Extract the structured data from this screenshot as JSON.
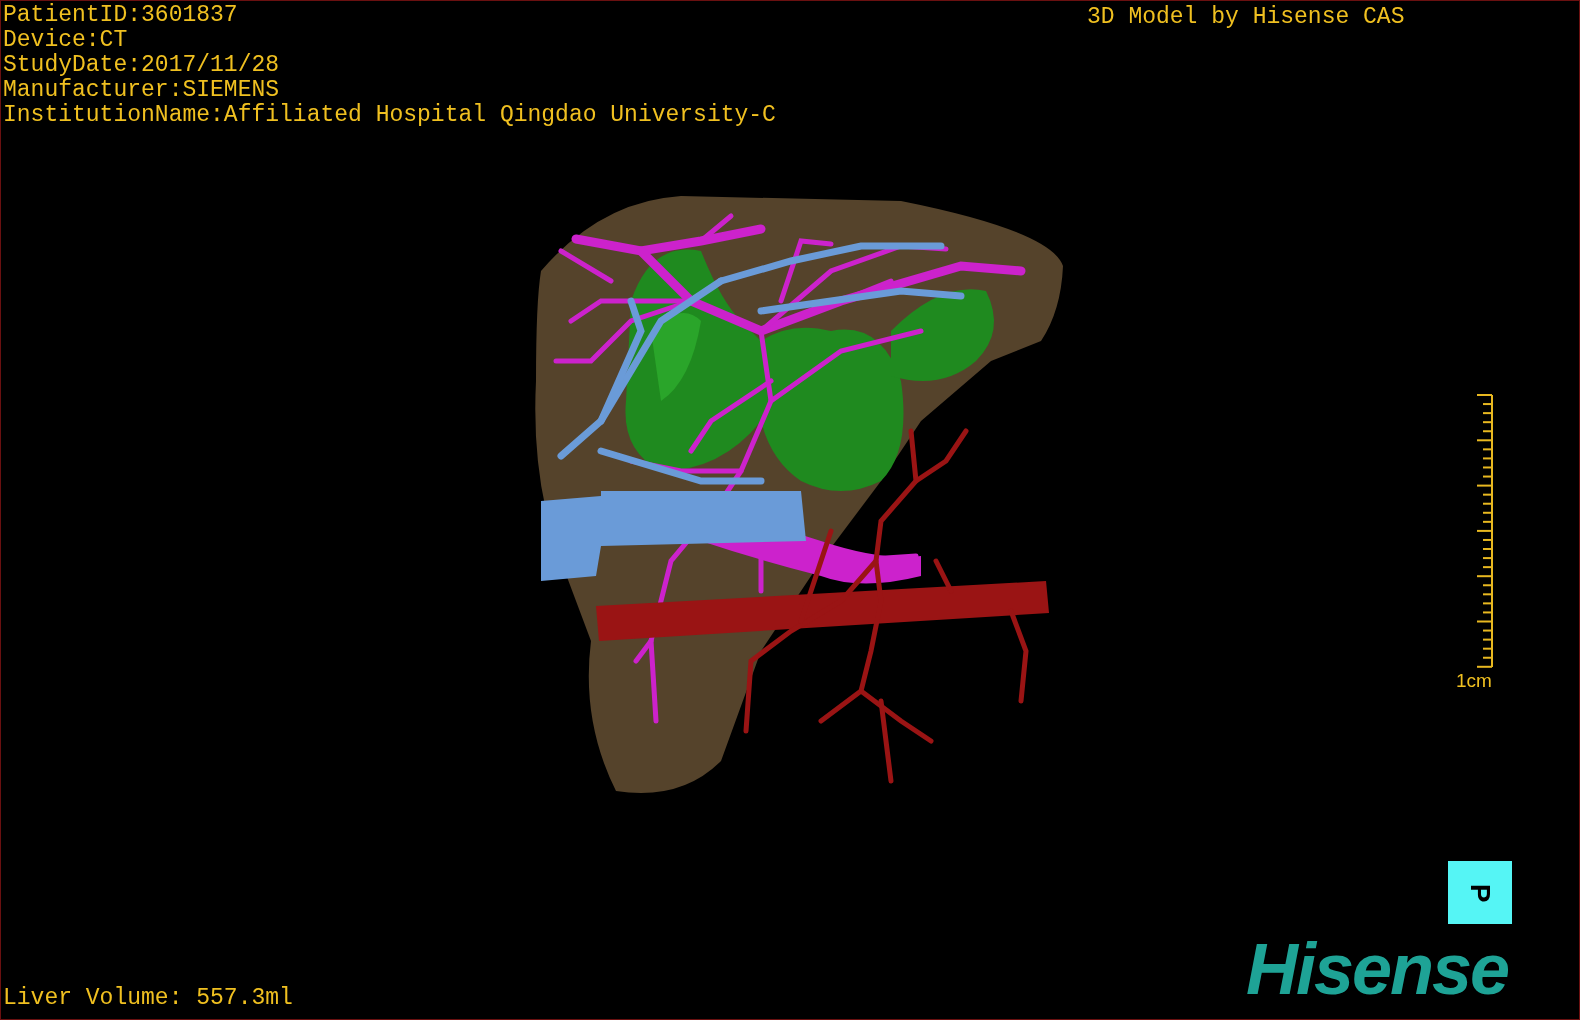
{
  "study_info": [
    "PatientID:3601837",
    "Device:CT",
    "StudyDate:2017/11/28",
    "Manufacturer:SIEMENS",
    "InstitutionName:Affiliated Hospital Qingdao University-C"
  ],
  "title": "3D Model by Hisense CAS",
  "scale_bar": {
    "label": "1cm"
  },
  "orientation_cube": {
    "label": "P"
  },
  "liver_volume": "Liver Volume: 557.3ml",
  "logo": "Hisense"
}
